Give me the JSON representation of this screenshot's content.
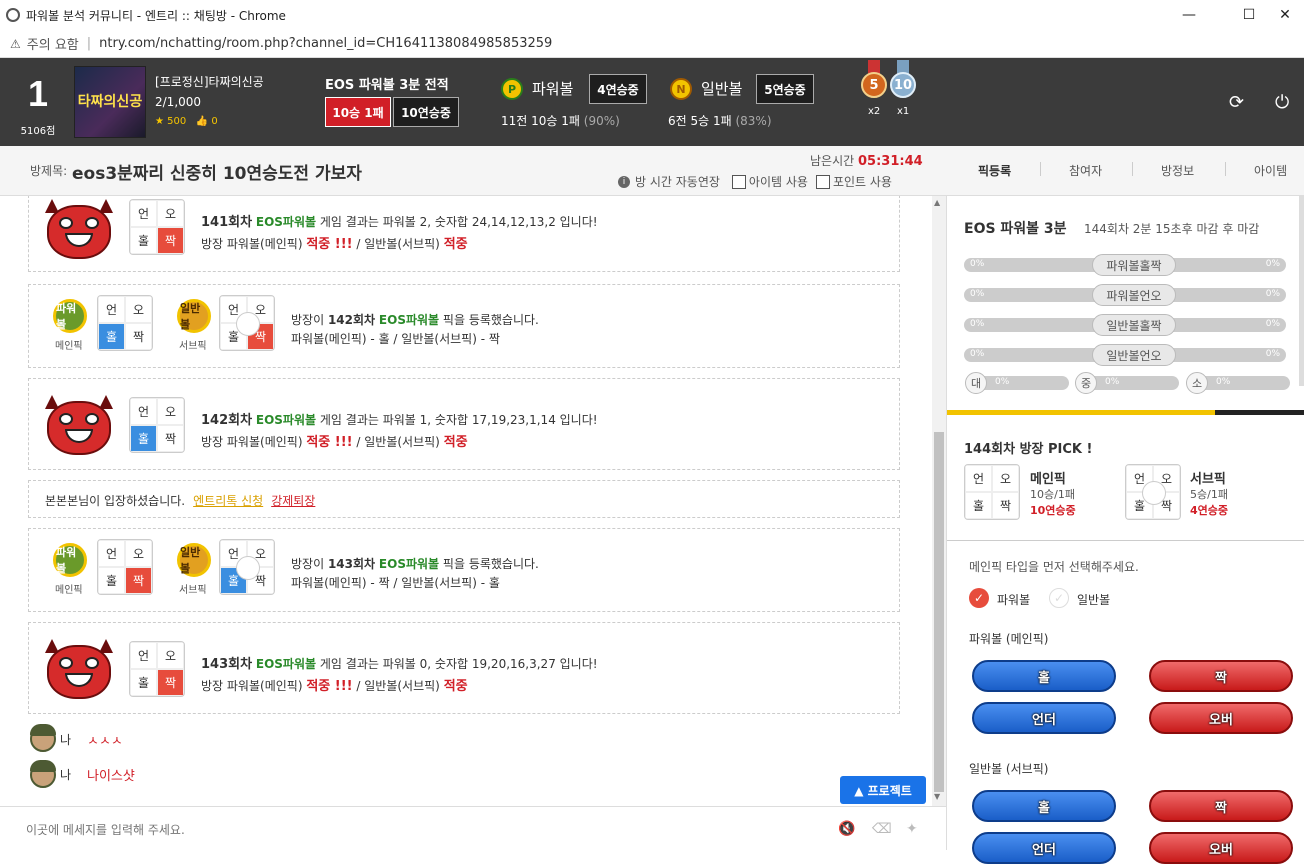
{
  "window": {
    "title": "파워볼 분석 커뮤니티 - 엔트리 :: 채팅방 - Chrome",
    "minimize": "—",
    "maximize": "☐",
    "close": "✕"
  },
  "address": {
    "warning": "⚠",
    "security_label": "주의 요함",
    "url": "ntry.com/nchatting/room.php?channel_id=CH1641138084985853259"
  },
  "header": {
    "rank": "1",
    "points": "5106점",
    "thumb_text": "타짜의신공",
    "user_name": "[프로정신]타짜의신공",
    "user_count": "2/1,000",
    "stars": "★ 500",
    "likes": "👍 0",
    "eos_title": "EOS 파워볼 3분 전적",
    "record_badge": "10승 1패",
    "streak_badge": "10연승중",
    "powerball": {
      "coin": "P",
      "label": "파워볼",
      "streak": "4연승중",
      "stat": "11전 10승 1패",
      "pct": "(90%)"
    },
    "normalball": {
      "coin": "N",
      "label": "일반볼",
      "streak": "5연승중",
      "stat": "6전 5승 1패",
      "pct": "(83%)"
    },
    "medals": [
      {
        "num": "5",
        "count": "x2",
        "color": "#d2661e"
      },
      {
        "num": "10",
        "count": "x1",
        "color": "#8ab0d0"
      }
    ],
    "refresh_icon": "⟳",
    "power_icon": "⏻"
  },
  "room": {
    "label": "방제목:",
    "title": "eos3분짜리 신중히 10연승도전 가보자",
    "remain_label": "남은시간",
    "remain_time": "05:31:44",
    "auto_extend": "방 시간 자동연장",
    "item_use": "아이템 사용",
    "point_use": "포인트 사용",
    "tabs": [
      "픽등록",
      "참여자",
      "방정보",
      "아이템"
    ]
  },
  "chat": {
    "results": [
      {
        "round": "141회차",
        "game": "EOS파워볼",
        "text": "게임 결과는 파워볼 2, 숫자합 24,14,12,13,2 입니다!",
        "line2_a": "방장 파워볼(메인픽)",
        "hit1": "적중 !!!",
        "line2_b": "/ 일반볼(서브픽)",
        "hit2": "적중",
        "cells": [
          "언",
          "오",
          "홀",
          "짝"
        ]
      },
      {
        "round": "142회차",
        "game": "EOS파워볼",
        "text": "게임 결과는 파워볼 1, 숫자합 17,19,23,1,14 입니다!",
        "line2_a": "방장 파워볼(메인픽)",
        "hit1": "적중 !!!",
        "line2_b": "/ 일반볼(서브픽)",
        "hit2": "적중",
        "cells": [
          "언",
          "오",
          "홀",
          "짝"
        ]
      },
      {
        "round": "143회차",
        "game": "EOS파워볼",
        "text": "게임 결과는 파워볼 0, 숫자합 19,20,16,3,27 입니다!",
        "line2_a": "방장 파워볼(메인픽)",
        "hit1": "적중 !!!",
        "line2_b": "/ 일반볼(서브픽)",
        "hit2": "적중",
        "cells": [
          "언",
          "오",
          "홀",
          "짝"
        ]
      }
    ],
    "picks": [
      {
        "prefix": "방장이",
        "round": "142회차",
        "game": "EOS파워볼",
        "suffix": "픽을 등록했습니다.",
        "detail": "파워볼(메인픽) - 홀 / 일반볼(서브픽) - 짝",
        "ball1": "파워볼",
        "ball1_lbl": "메인픽",
        "ball2": "일반볼",
        "ball2_lbl": "서브픽"
      },
      {
        "prefix": "방장이",
        "round": "143회차",
        "game": "EOS파워볼",
        "suffix": "픽을 등록했습니다.",
        "detail": "파워볼(메인픽) - 짝 / 일반볼(서브픽) - 홀",
        "ball1": "파워볼",
        "ball1_lbl": "메인픽",
        "ball2": "일반볼",
        "ball2_lbl": "서브픽"
      }
    ],
    "enter": {
      "text": "본본본님이 입장하셨습니다.",
      "link1": "엔트리톡 신청",
      "link2": "강제퇴장"
    },
    "me": [
      {
        "label": "나",
        "msg": "ㅅㅅㅅ"
      },
      {
        "label": "나",
        "msg": "나이스샷"
      }
    ],
    "project_button": "▲ 프로젝트",
    "input_placeholder": "이곳에 메세지를 입력해 주세요.",
    "mute_icon": "🔇",
    "eraser_icon": "⌫",
    "magic_icon": "✦"
  },
  "rpanel": {
    "title": "EOS 파워볼 3분",
    "sub": "144회차 2분 15초후 마감 후 마감",
    "bars": [
      {
        "label": "파워볼홀짝",
        "left": "0%",
        "right": "0%"
      },
      {
        "label": "파워볼언오",
        "left": "0%",
        "right": "0%"
      },
      {
        "label": "일반볼홀짝",
        "left": "0%",
        "right": "0%"
      },
      {
        "label": "일반볼언오",
        "left": "0%",
        "right": "0%"
      }
    ],
    "sizes": [
      {
        "label": "대",
        "pct": "0%"
      },
      {
        "label": "중",
        "pct": "0%"
      },
      {
        "label": "소",
        "pct": "0%"
      }
    ],
    "pick_title": "144회차 방장 PICK !",
    "main": {
      "label": "메인픽",
      "record": "10승/1패",
      "streak": "10연승중"
    },
    "sub_pick": {
      "label": "서브픽",
      "record": "5승/1패",
      "streak": "4연승중"
    },
    "note": "메인픽 타입을 먼저 선택해주세요.",
    "radio1": "파워볼",
    "radio2": "일반볼",
    "section1": "파워볼 (메인픽)",
    "section2": "일반볼 (서브픽)",
    "btn_odd": "홀",
    "btn_even": "짝",
    "btn_under": "언더",
    "btn_over": "오버"
  }
}
